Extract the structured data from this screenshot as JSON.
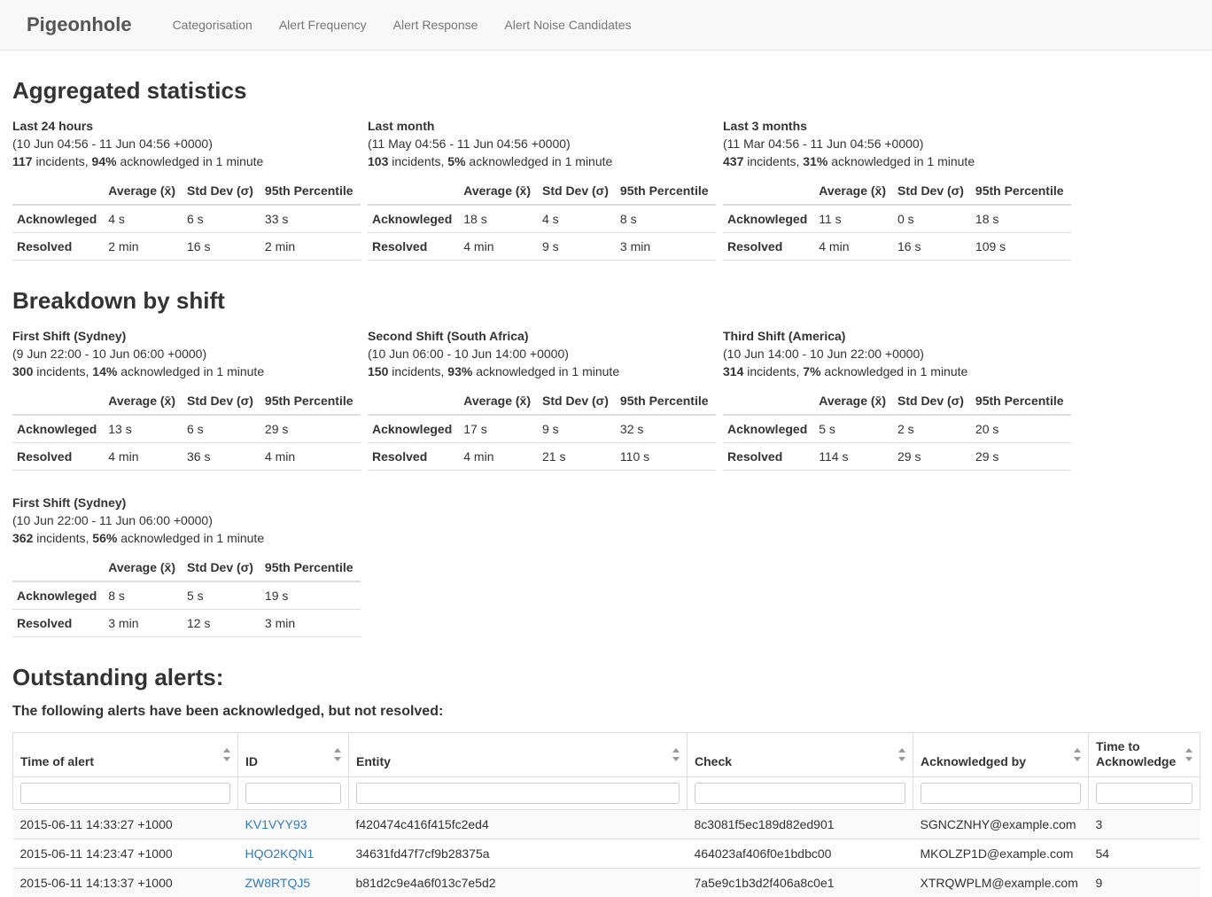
{
  "navbar": {
    "brand": "Pigeonhole",
    "items": [
      {
        "label": "Categorisation"
      },
      {
        "label": "Alert Frequency"
      },
      {
        "label": "Alert Response"
      },
      {
        "label": "Alert Noise Candidates"
      }
    ]
  },
  "shared": {
    "col_avg": "Average (x̄)",
    "col_std": "Std Dev (σ)",
    "col_95": "95th Percentile",
    "row_ack": "Acknowleged",
    "row_res": "Resolved",
    "incidents_word": "incidents,",
    "ack_phrase": "acknowledged in 1 minute"
  },
  "aggregated": {
    "title": "Aggregated statistics",
    "blocks": [
      {
        "title": "Last 24 hours",
        "range": "(10 Jun 04:56 - 11 Jun 04:56 +0000)",
        "count": "117",
        "pct": "94%",
        "ack": [
          "4 s",
          "6 s",
          "33 s"
        ],
        "res": [
          "2 min",
          "16 s",
          "2 min"
        ]
      },
      {
        "title": "Last month",
        "range": "(11 May 04:56 - 11 Jun 04:56 +0000)",
        "count": "103",
        "pct": "5%",
        "ack": [
          "18 s",
          "4 s",
          "8 s"
        ],
        "res": [
          "4 min",
          "9 s",
          "3 min"
        ]
      },
      {
        "title": "Last 3 months",
        "range": "(11 Mar 04:56 - 11 Jun 04:56 +0000)",
        "count": "437",
        "pct": "31%",
        "ack": [
          "11 s",
          "0 s",
          "18 s"
        ],
        "res": [
          "4 min",
          "16 s",
          "109 s"
        ]
      }
    ]
  },
  "shifts": {
    "title": "Breakdown by shift",
    "blocks": [
      {
        "title": "First Shift (Sydney)",
        "range": "(9 Jun 22:00 - 10 Jun 06:00 +0000)",
        "count": "300",
        "pct": "14%",
        "ack": [
          "13 s",
          "6 s",
          "29 s"
        ],
        "res": [
          "4 min",
          "36 s",
          "4 min"
        ]
      },
      {
        "title": "Second Shift (South Africa)",
        "range": "(10 Jun 06:00 - 10 Jun 14:00 +0000)",
        "count": "150",
        "pct": "93%",
        "ack": [
          "17 s",
          "9 s",
          "32 s"
        ],
        "res": [
          "4 min",
          "21 s",
          "110 s"
        ]
      },
      {
        "title": "Third Shift (America)",
        "range": "(10 Jun 14:00 - 10 Jun 22:00 +0000)",
        "count": "314",
        "pct": "7%",
        "ack": [
          "5 s",
          "2 s",
          "20 s"
        ],
        "res": [
          "114 s",
          "29 s",
          "29 s"
        ]
      },
      {
        "title": "First Shift (Sydney)",
        "range": "(10 Jun 22:00 - 11 Jun 06:00 +0000)",
        "count": "362",
        "pct": "56%",
        "ack": [
          "8 s",
          "5 s",
          "19 s"
        ],
        "res": [
          "3 min",
          "12 s",
          "3 min"
        ]
      }
    ]
  },
  "outstanding": {
    "title": "Outstanding alerts:",
    "subtitle": "The following alerts have been acknowledged, but not resolved:",
    "columns": [
      "Time of alert",
      "ID",
      "Entity",
      "Check",
      "Acknowledged by",
      "Time to Acknowledge"
    ],
    "rows": [
      {
        "time": "2015-06-11 14:33:27 +1000",
        "id": "KV1VYY93",
        "entity": "f420474c416f415fc2ed4",
        "check": "8c3081f5ec189d82ed901",
        "ack_by": "SGNCZNHY@example.com",
        "tta": "3"
      },
      {
        "time": "2015-06-11 14:23:47 +1000",
        "id": "HQO2KQN1",
        "entity": "34631fd47f7cf9b28375a",
        "check": "464023af406f0e1bdbc00",
        "ack_by": "MKOLZP1D@example.com",
        "tta": "54"
      },
      {
        "time": "2015-06-11 14:13:37 +1000",
        "id": "ZW8RTQJ5",
        "entity": "b81d2c9e4a6f013c7e5d2",
        "check": "7a5e9c1b3d2f406a8c0e1",
        "ack_by": "XTRQWPLM@example.com",
        "tta": "9"
      }
    ]
  }
}
